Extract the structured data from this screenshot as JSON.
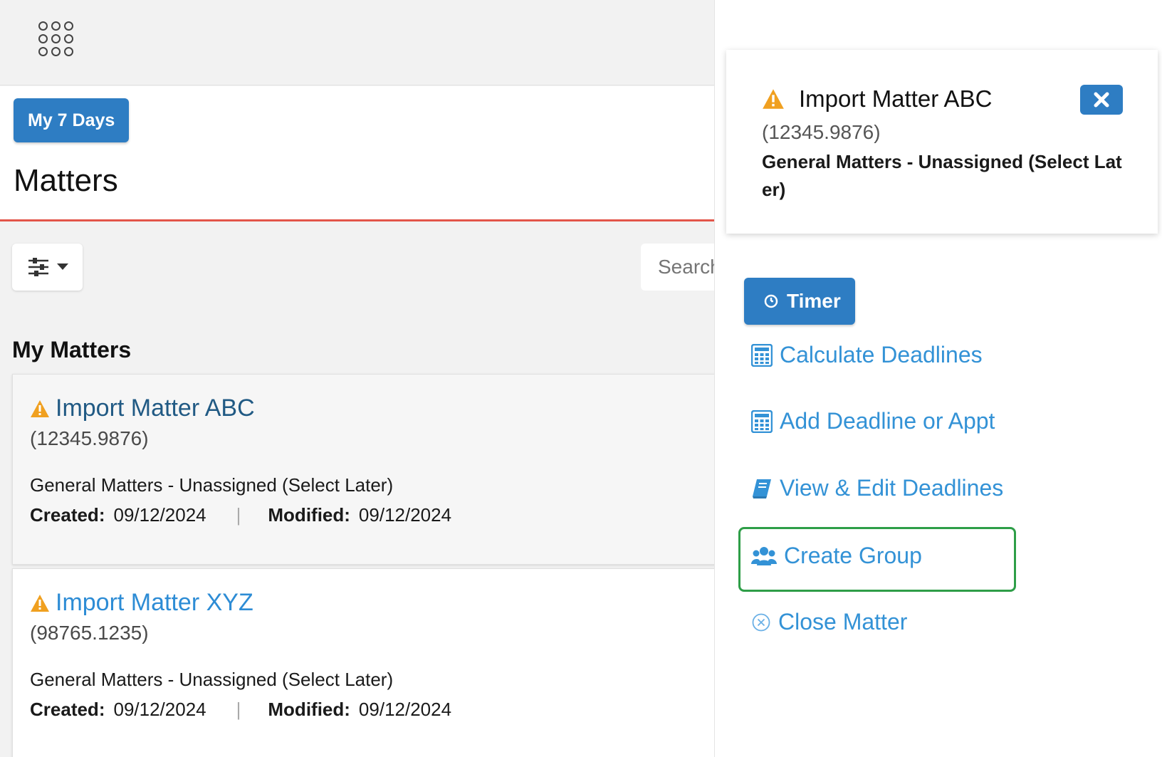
{
  "topbar": {
    "apps_icon": "apps-grid-icon"
  },
  "header": {
    "my7_label": "My 7 Days",
    "page_title": "Matters"
  },
  "toolbar": {
    "filter_icon": "sliders-icon",
    "search_placeholder": "Search"
  },
  "section": {
    "title": "My Matters"
  },
  "matters": [
    {
      "title": "Import Matter ABC",
      "number": "(12345.9876)",
      "type": "General Matters - Unassigned (Select Later)",
      "created_label": "Created:",
      "created": "09/12/2024",
      "modified_label": "Modified:",
      "modified": "09/12/2024"
    },
    {
      "title": "Import Matter XYZ",
      "number": "(98765.1235)",
      "type": "General Matters - Unassigned (Select Later)",
      "created_label": "Created:",
      "created": "09/12/2024",
      "modified_label": "Modified:",
      "modified": "09/12/2024"
    }
  ],
  "detail": {
    "title": "Import Matter ABC",
    "number": "(12345.9876)",
    "type": "General Matters - Unassigned (Select Later)",
    "timer_label": "Timer",
    "actions": {
      "calc": "Calculate Deadlines",
      "add": "Add Deadline or Appt",
      "view": "View & Edit Deadlines",
      "group": "Create Group",
      "close": "Close Matter"
    }
  },
  "colors": {
    "brand_blue": "#2e7dc3",
    "link_blue": "#3392d6",
    "warning_orange": "#f0a020",
    "accent_red": "#e3554a",
    "highlight_green": "#2e9e48"
  }
}
